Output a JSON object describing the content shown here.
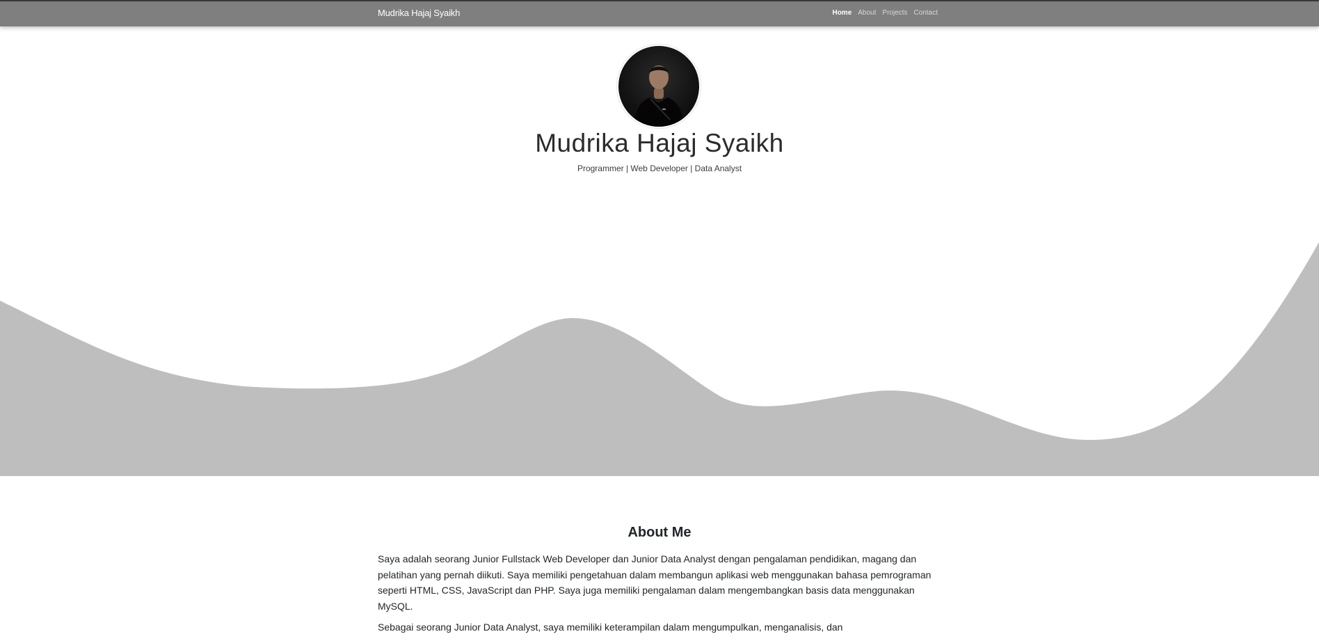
{
  "navbar": {
    "brand": "Mudrika Hajaj Syaikh",
    "links": [
      {
        "label": "Home",
        "active": true
      },
      {
        "label": "About",
        "active": false
      },
      {
        "label": "Projects",
        "active": false
      },
      {
        "label": "Contact",
        "active": false
      }
    ]
  },
  "hero": {
    "name": "Mudrika Hajaj Syaikh",
    "subtitle": "Programmer | Web Developer | Data Analyst"
  },
  "about": {
    "title": "About Me",
    "paragraphs": [
      "Saya adalah seorang Junior Fullstack Web Developer dan Junior Data Analyst dengan pengalaman pendidikan, magang dan pelatihan yang pernah diikuti. Saya memiliki pengetahuan dalam membangun aplikasi web menggunakan bahasa pemrograman seperti HTML, CSS, JavaScript dan PHP. Saya juga memiliki pengalaman dalam mengembangkan basis data menggunakan MySQL.",
      "Sebagai seorang Junior Data Analyst, saya memiliki keterampilan dalam mengumpulkan, menganalisis, dan"
    ]
  },
  "colors": {
    "navbar": "#7f7f7f",
    "wave": "#bebebe",
    "background": "#ffffff"
  }
}
